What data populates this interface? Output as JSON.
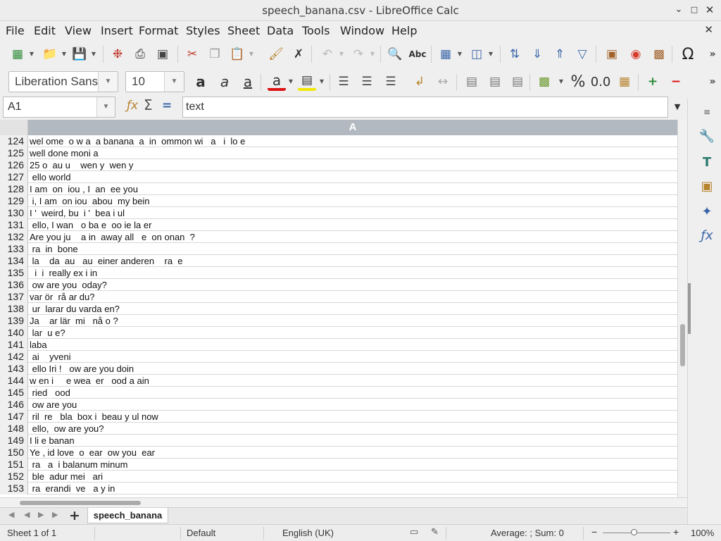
{
  "window": {
    "title": "speech_banana.csv - LibreOffice Calc"
  },
  "menu": [
    "File",
    "Edit",
    "View",
    "Insert",
    "Format",
    "Styles",
    "Sheet",
    "Data",
    "Tools",
    "Window",
    "Help"
  ],
  "format_toolbar": {
    "font_name": "Liberation Sans",
    "font_size": "10"
  },
  "formula_bar": {
    "name_box": "A1",
    "content": "text"
  },
  "column_header": "A",
  "rows": [
    {
      "n": "124",
      "text": "wel ome  o w a  a banana  a  in  ommon wi   a   i  lo e"
    },
    {
      "n": "125",
      "text": "well done moni a"
    },
    {
      "n": "126",
      "text": "25 o  au u    wen y  wen y"
    },
    {
      "n": "127",
      "text": " ello world"
    },
    {
      "n": "128",
      "text": "I am  on  iou , I  an  ee you"
    },
    {
      "n": "129",
      "text": " i, I am  on iou  abou  my bein"
    },
    {
      "n": "130",
      "text": "I '  weird, bu  i '  bea i ul"
    },
    {
      "n": "131",
      "text": " ello, I wan   o ba e  oo ie la er"
    },
    {
      "n": "132",
      "text": "Are you ju    a in  away all   e  on onan  ?"
    },
    {
      "n": "133",
      "text": " ra  in  bone"
    },
    {
      "n": "134",
      "text": " la    da  au   au  einer anderen    ra  e"
    },
    {
      "n": "135",
      "text": "  i  i  really ex i in"
    },
    {
      "n": "136",
      "text": " ow are you  oday?"
    },
    {
      "n": "137",
      "text": "var ör  rå ar du?"
    },
    {
      "n": "138",
      "text": " ur  larar du varda en?"
    },
    {
      "n": "139",
      "text": "Ja    ar lär  mi   nå o ?"
    },
    {
      "n": "140",
      "text": " lar  u e?"
    },
    {
      "n": "141",
      "text": "laba"
    },
    {
      "n": "142",
      "text": " ai    yveni"
    },
    {
      "n": "143",
      "text": " ello Iri !   ow are you doin"
    },
    {
      "n": "144",
      "text": "w en i     e wea  er   ood a ain"
    },
    {
      "n": "145",
      "text": " ried   ood"
    },
    {
      "n": "146",
      "text": " ow are you"
    },
    {
      "n": "147",
      "text": " ril  re   bla  box i  beau y ul now"
    },
    {
      "n": "148",
      "text": " ello,  ow are you?"
    },
    {
      "n": "149",
      "text": "I li e banan"
    },
    {
      "n": "150",
      "text": "Ye , id love  o  ear  ow you  ear"
    },
    {
      "n": "151",
      "text": " ra   a  i balanum minum"
    },
    {
      "n": "152",
      "text": " ble  adur mei   ari"
    },
    {
      "n": "153",
      "text": " ra  erandi  ve   a y in"
    }
  ],
  "sheet_tabs": {
    "add_label": "+",
    "active": "speech_banana"
  },
  "status_bar": {
    "sheet": "Sheet 1 of 1",
    "page_style": "Default",
    "language": "English (UK)",
    "summary": "Average: ; Sum: 0",
    "zoom": "100%"
  },
  "colors": {
    "column_header_selected": "#b3b9c0",
    "row_header": "#efefef",
    "grid_line": "#d7d7d7"
  }
}
